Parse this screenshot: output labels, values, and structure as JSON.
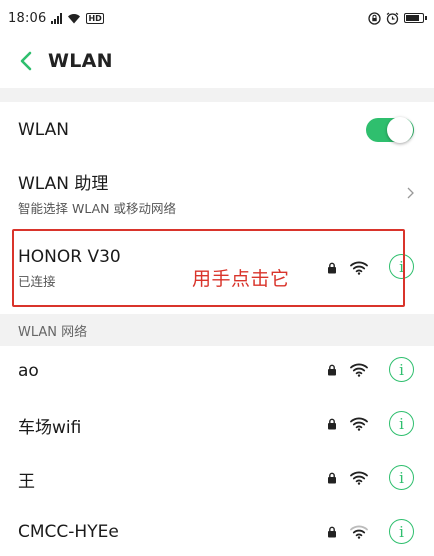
{
  "status_bar": {
    "time": "18:06",
    "network_badge": "HD"
  },
  "header": {
    "title": "WLAN"
  },
  "wlan_toggle": {
    "label": "WLAN",
    "on": true
  },
  "wlan_assistant": {
    "label": "WLAN 助理",
    "description": "智能选择 WLAN 或移动网络"
  },
  "connected_network": {
    "ssid": "HONOR V30",
    "status": "已连接"
  },
  "annotation": {
    "text": "用手点击它"
  },
  "network_section": {
    "label": "WLAN 网络"
  },
  "networks": [
    {
      "ssid": "ao"
    },
    {
      "ssid": "车场wifi"
    },
    {
      "ssid": "王"
    },
    {
      "ssid": "CMCC-HYEe"
    }
  ],
  "colors": {
    "accent": "#2fbf6e",
    "annotation": "#d9342b",
    "section_bg": "#f2f2f2"
  }
}
